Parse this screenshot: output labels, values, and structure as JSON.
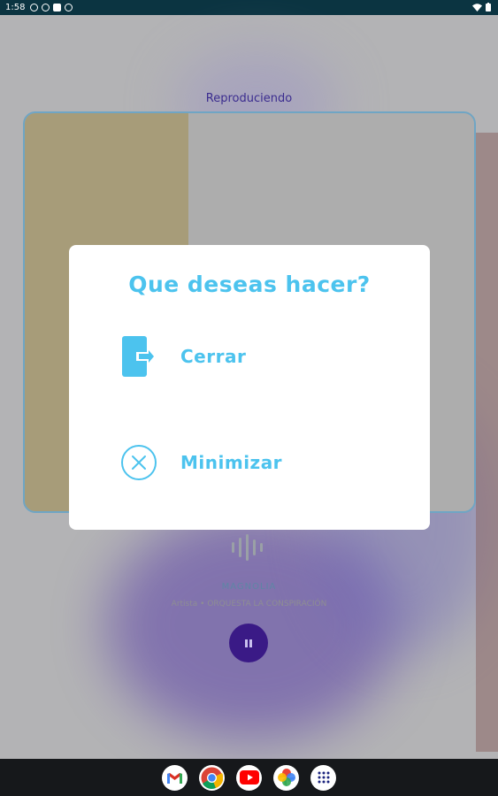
{
  "status_bar": {
    "time": "1:58"
  },
  "player": {
    "header": "Reproduciendo",
    "track_title": "MAGNOLIA",
    "artist_line": "Artista • ORQUESTA LA CONSPIRACIÓN"
  },
  "dialog": {
    "title": "Que deseas hacer?",
    "close_label": "Cerrar",
    "minimize_label": "Minimizar"
  },
  "taskbar": {
    "apps": [
      "gmail",
      "chrome",
      "youtube",
      "photos",
      "app-drawer"
    ]
  },
  "colors": {
    "accent": "#4cc3ee",
    "status_bar": "#0b3441",
    "taskbar": "#16181b",
    "pause_button": "#3a1a86"
  }
}
